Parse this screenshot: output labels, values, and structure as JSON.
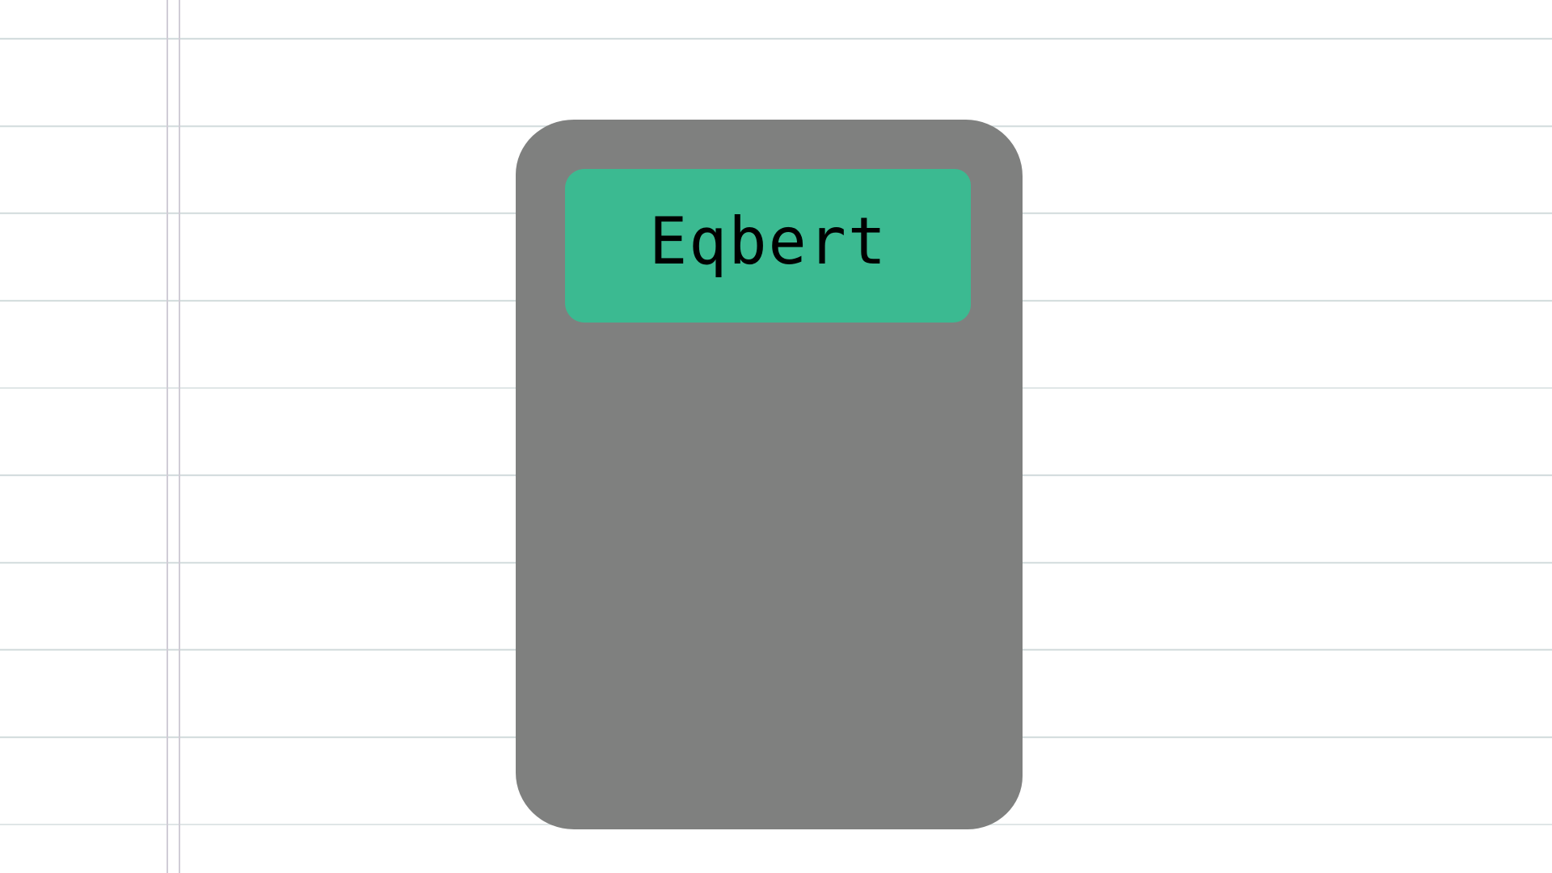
{
  "calculator": {
    "display_text": "Eqbert"
  },
  "colors": {
    "paper": "#ffffff",
    "rule_line": "#d3dcdd",
    "margin_line": "#d0ccd6",
    "calculator_body": "#7f807f",
    "display_background": "#3bba91",
    "display_text": "#000000"
  }
}
